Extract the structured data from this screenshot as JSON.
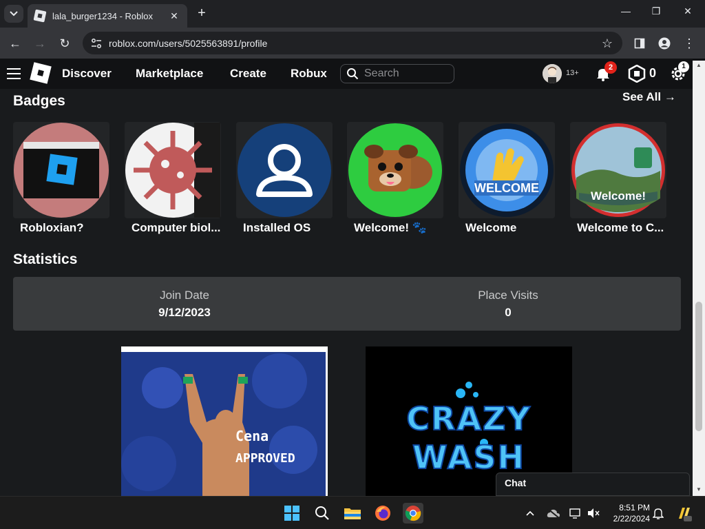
{
  "browser": {
    "tab_title": "lala_burger1234 - Roblox",
    "url": "roblox.com/users/5025563891/profile"
  },
  "nav": {
    "links": [
      "Discover",
      "Marketplace",
      "Create",
      "Robux"
    ],
    "search_placeholder": "Search",
    "age_label": "13+",
    "notifications_count": "2",
    "robux_balance": "0",
    "settings_count": "1"
  },
  "badges": {
    "title": "Badges",
    "see_all": "See All",
    "items": [
      {
        "name": "Robloxian?",
        "icon": "window-app-icon"
      },
      {
        "name": "Computer biol...",
        "icon": "virus-icon"
      },
      {
        "name": "Installed OS",
        "icon": "user-outline-icon"
      },
      {
        "name": "Welcome! 🐾",
        "icon": "dog-icon"
      },
      {
        "name": "Welcome",
        "icon": "clapping-hands-icon"
      },
      {
        "name": "Welcome to C...",
        "icon": "landscape-icon"
      }
    ]
  },
  "statistics": {
    "title": "Statistics",
    "join_date_label": "Join Date",
    "join_date": "9/12/2023",
    "place_visits_label": "Place Visits",
    "place_visits": "0"
  },
  "games": [
    {
      "overlay_text_1": "Cena",
      "overlay_text_2": "APPROVED"
    },
    {
      "overlay_text_1": "CRAZY",
      "overlay_text_2": "WASH"
    }
  ],
  "chat": {
    "label": "Chat"
  },
  "taskbar": {
    "time": "8:51 PM",
    "date": "2/22/2024"
  },
  "colors": {
    "page_bg": "#191b1d",
    "card_bg": "#393b3d",
    "notification": "#e2231a"
  }
}
